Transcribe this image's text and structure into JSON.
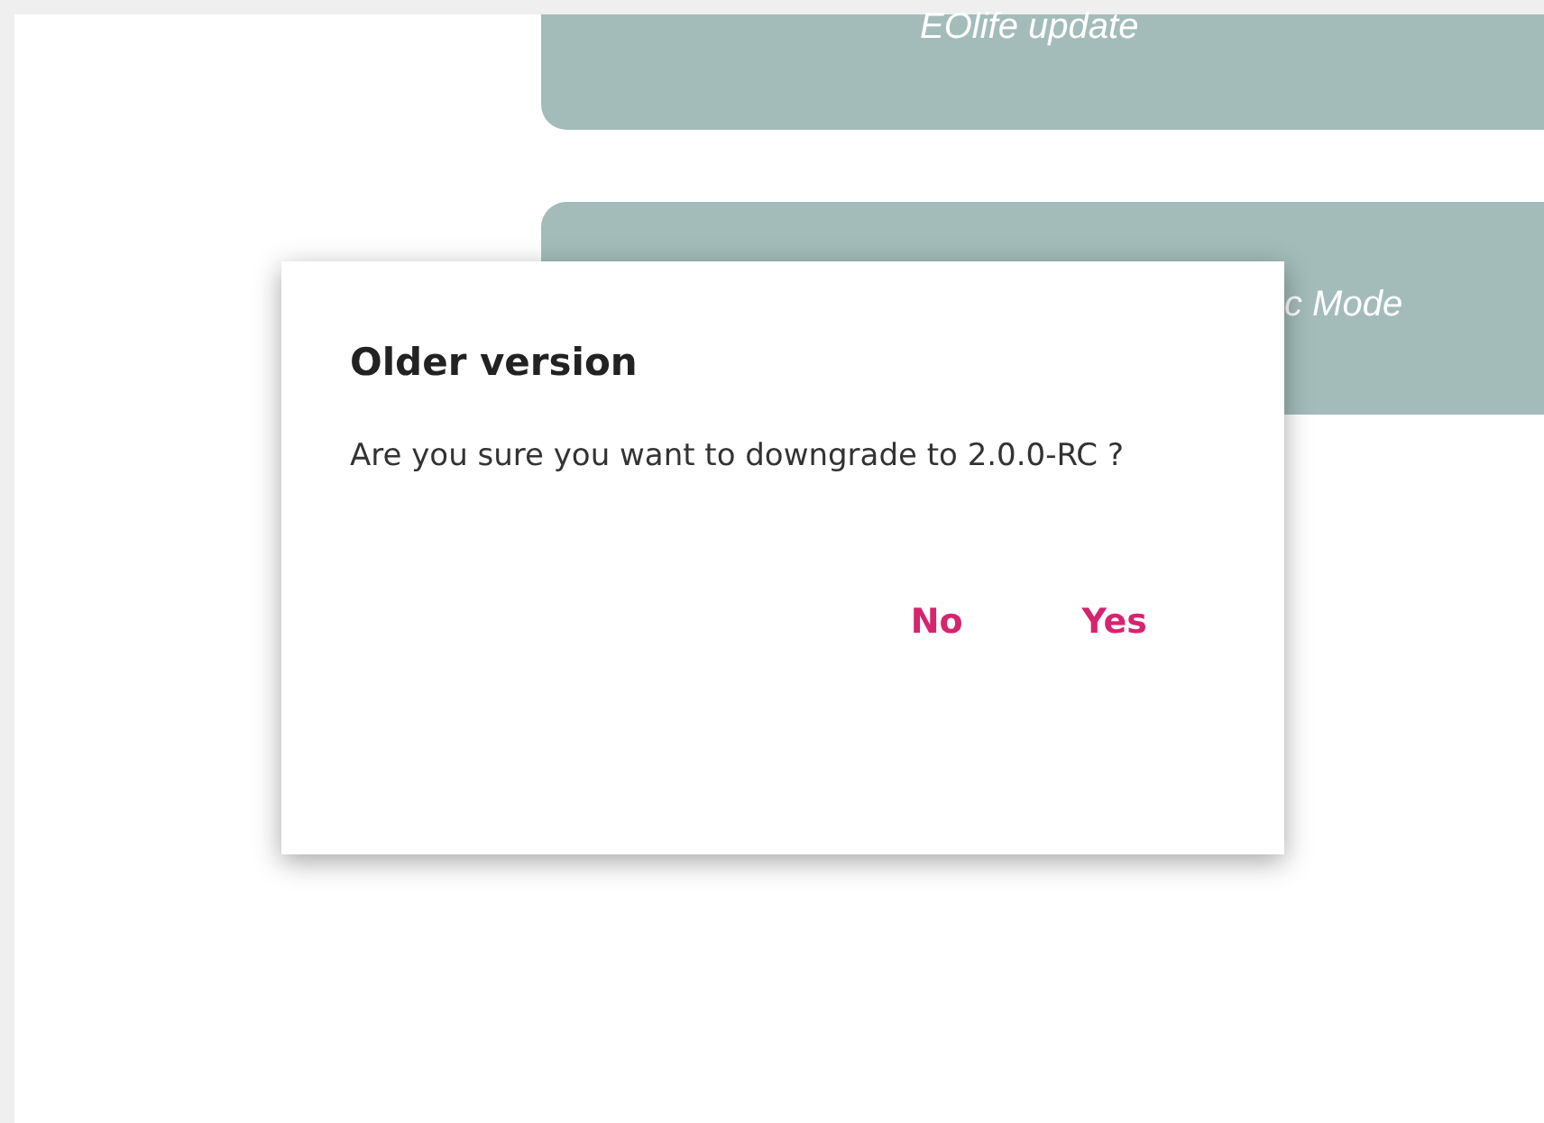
{
  "cards": [
    {
      "label": "EOlife update"
    },
    {
      "label": "c Mode"
    }
  ],
  "dialog": {
    "title": "Older version",
    "message": "Are you sure you want to downgrade to 2.0.0-RC ?",
    "buttons": [
      {
        "label": "No"
      },
      {
        "label": "Yes"
      }
    ]
  }
}
